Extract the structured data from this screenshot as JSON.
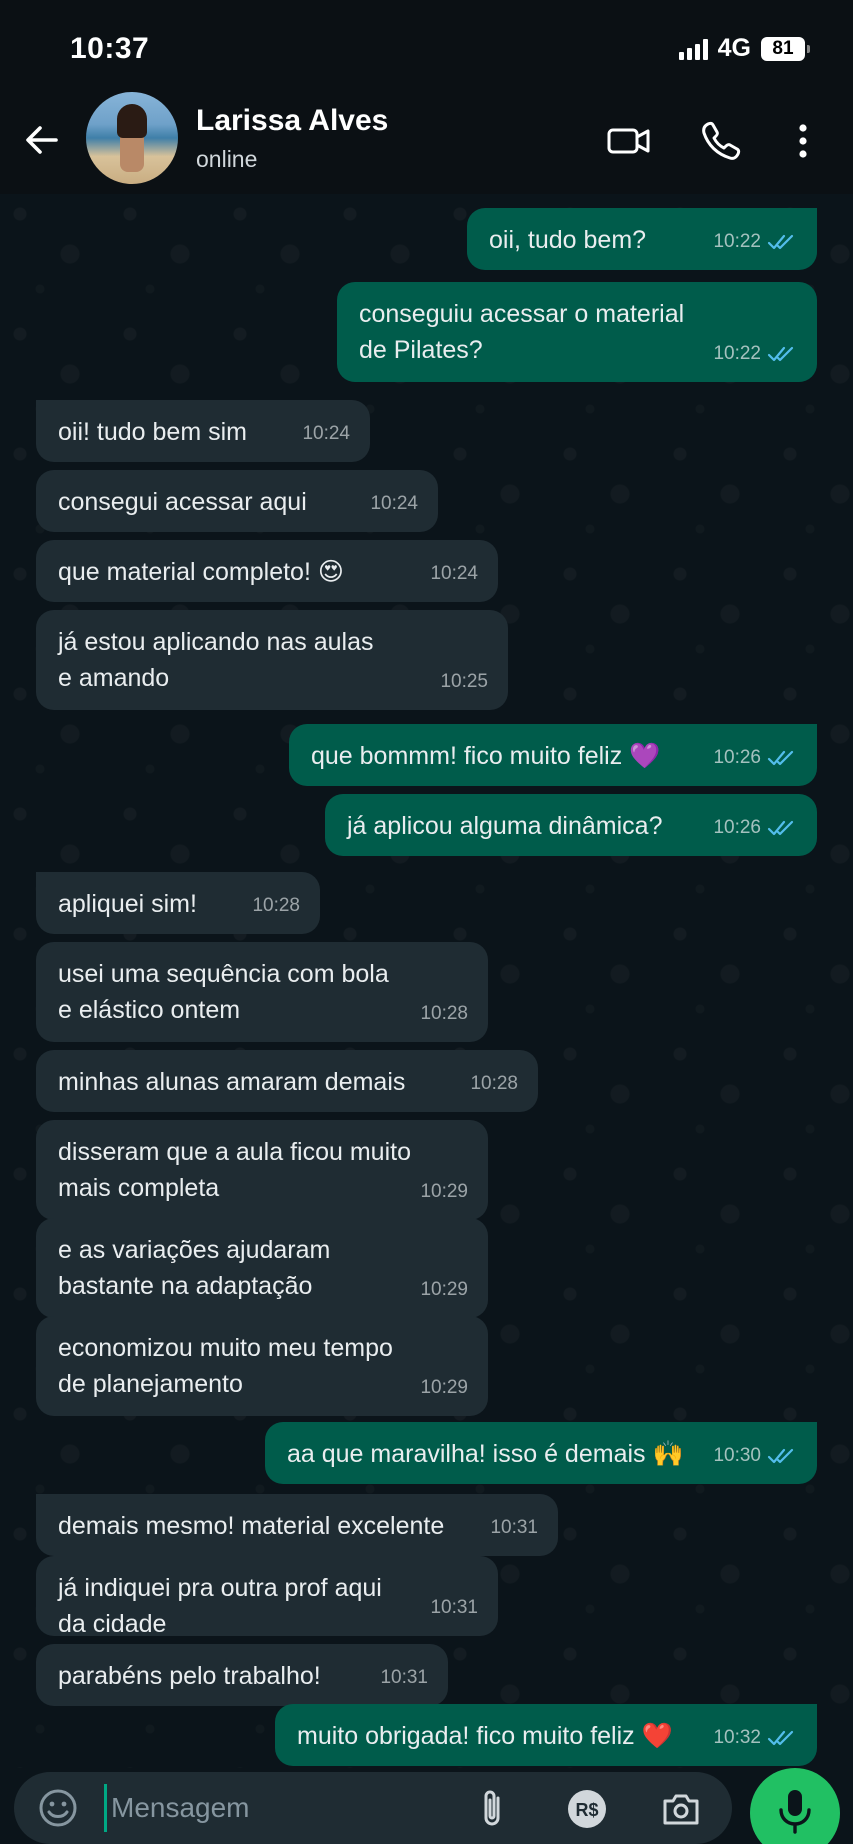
{
  "status_bar": {
    "time": "10:37",
    "network": "4G",
    "battery": "81"
  },
  "header": {
    "contact_name": "Larissa Alves",
    "contact_status": "online",
    "icons": [
      "back-arrow-icon",
      "video-call-icon",
      "voice-call-icon",
      "more-options-icon"
    ]
  },
  "messages": [
    {
      "dir": "out",
      "text": "oii, tudo bem?",
      "time": "10:22",
      "read": true
    },
    {
      "dir": "out",
      "text": "conseguiu acessar o material\nde Pilates?",
      "time": "10:22",
      "read": true
    },
    {
      "dir": "in",
      "text": "oii! tudo bem sim",
      "time": "10:24"
    },
    {
      "dir": "in",
      "text": "consegui acessar aqui",
      "time": "10:24"
    },
    {
      "dir": "in",
      "text": "que material completo! 😍",
      "time": "10:24"
    },
    {
      "dir": "in",
      "text": "já estou aplicando nas aulas\ne amando",
      "time": "10:25"
    },
    {
      "dir": "out",
      "text": "que bommm! fico muito feliz 💜",
      "time": "10:26",
      "read": true
    },
    {
      "dir": "out",
      "text": "já aplicou alguma dinâmica?",
      "time": "10:26",
      "read": true
    },
    {
      "dir": "in",
      "text": "apliquei sim!",
      "time": "10:28"
    },
    {
      "dir": "in",
      "text": "usei uma sequência com bola\ne elástico ontem",
      "time": "10:28"
    },
    {
      "dir": "in",
      "text": "minhas alunas amaram demais",
      "time": "10:28"
    },
    {
      "dir": "in",
      "text": "disseram que a aula ficou muito\nmais completa",
      "time": "10:29"
    },
    {
      "dir": "in",
      "text": "e as variações ajudaram\nbastante na adaptação",
      "time": "10:29"
    },
    {
      "dir": "in",
      "text": "economizou muito meu tempo\nde planejamento",
      "time": "10:29"
    },
    {
      "dir": "out",
      "text": "aa que maravilha! isso é demais 🙌",
      "time": "10:30",
      "read": true
    },
    {
      "dir": "in",
      "text": "demais mesmo! material excelente",
      "time": "10:31"
    },
    {
      "dir": "in",
      "text": "já indiquei pra outra prof aqui\nda cidade",
      "time": "10:31"
    },
    {
      "dir": "in",
      "text": "parabéns pelo trabalho!",
      "time": "10:31"
    },
    {
      "dir": "out",
      "text": "muito obrigada! fico muito feliz ❤️",
      "time": "10:32",
      "read": true
    }
  ],
  "composer": {
    "placeholder": "Mensagem",
    "icons": [
      "emoji-icon",
      "attach-icon",
      "payment-icon",
      "camera-icon",
      "mic-icon"
    ],
    "payment_label": "R$"
  },
  "colors": {
    "background": "#0b141a",
    "incoming_bubble": "#1f2c33",
    "outgoing_bubble": "#005c4b",
    "read_ticks": "#53bdeb",
    "accent": "#21c063"
  }
}
